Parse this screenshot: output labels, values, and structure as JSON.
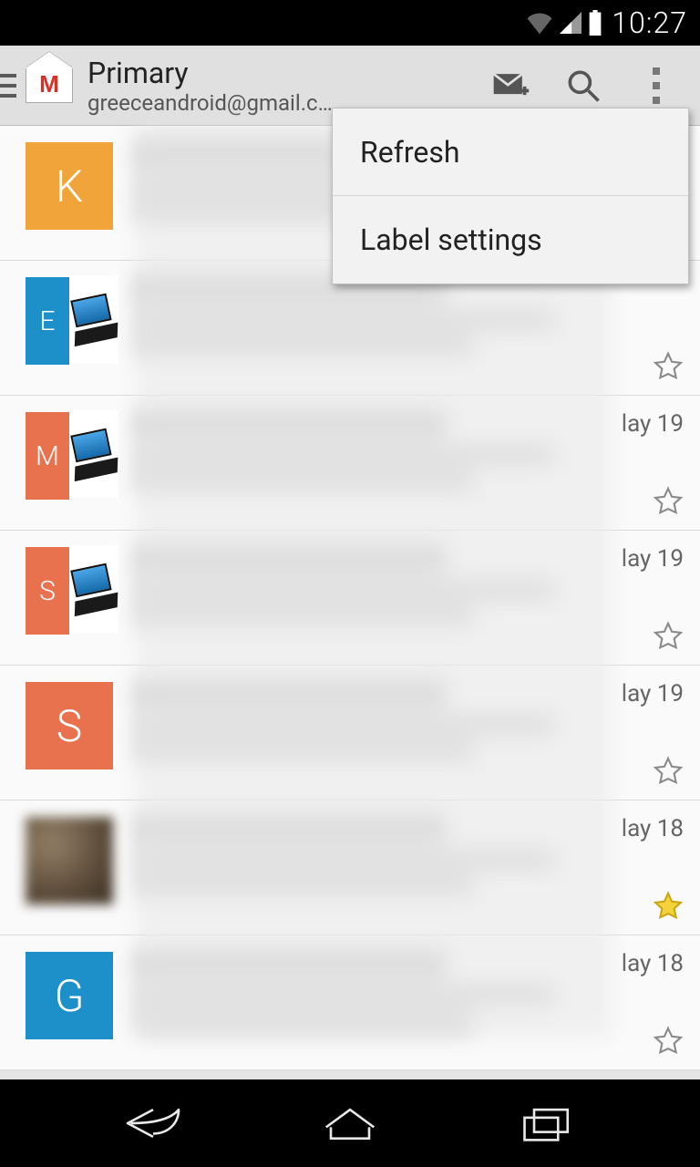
{
  "status": {
    "time": "10:27"
  },
  "action_bar": {
    "title": "Primary",
    "account": "greeceandroid@gmail.c…"
  },
  "popup": {
    "items": [
      "Refresh",
      "Label settings"
    ]
  },
  "emails": [
    {
      "avatar_letter": "K",
      "avatar_color": "#f0a43a",
      "layout": "single",
      "date": "",
      "starred": false,
      "show_star": false
    },
    {
      "avatar_letter": "E",
      "avatar_color": "#1e90c9",
      "layout": "split",
      "date": "",
      "starred": false,
      "show_star": true
    },
    {
      "avatar_letter": "M",
      "avatar_color": "#e8714e",
      "layout": "split",
      "date": "lay 19",
      "starred": false,
      "show_star": true
    },
    {
      "avatar_letter": "S",
      "avatar_color": "#e8714e",
      "layout": "split",
      "date": "lay 19",
      "starred": false,
      "show_star": true
    },
    {
      "avatar_letter": "S",
      "avatar_color": "#e8714e",
      "layout": "single",
      "date": "lay 19",
      "starred": false,
      "show_star": true
    },
    {
      "avatar_letter": "",
      "avatar_color": "photo",
      "layout": "photo",
      "date": "lay 18",
      "starred": true,
      "show_star": true
    },
    {
      "avatar_letter": "G",
      "avatar_color": "#1e90c9",
      "layout": "single",
      "date": "lay 18",
      "starred": false,
      "show_star": true
    }
  ]
}
